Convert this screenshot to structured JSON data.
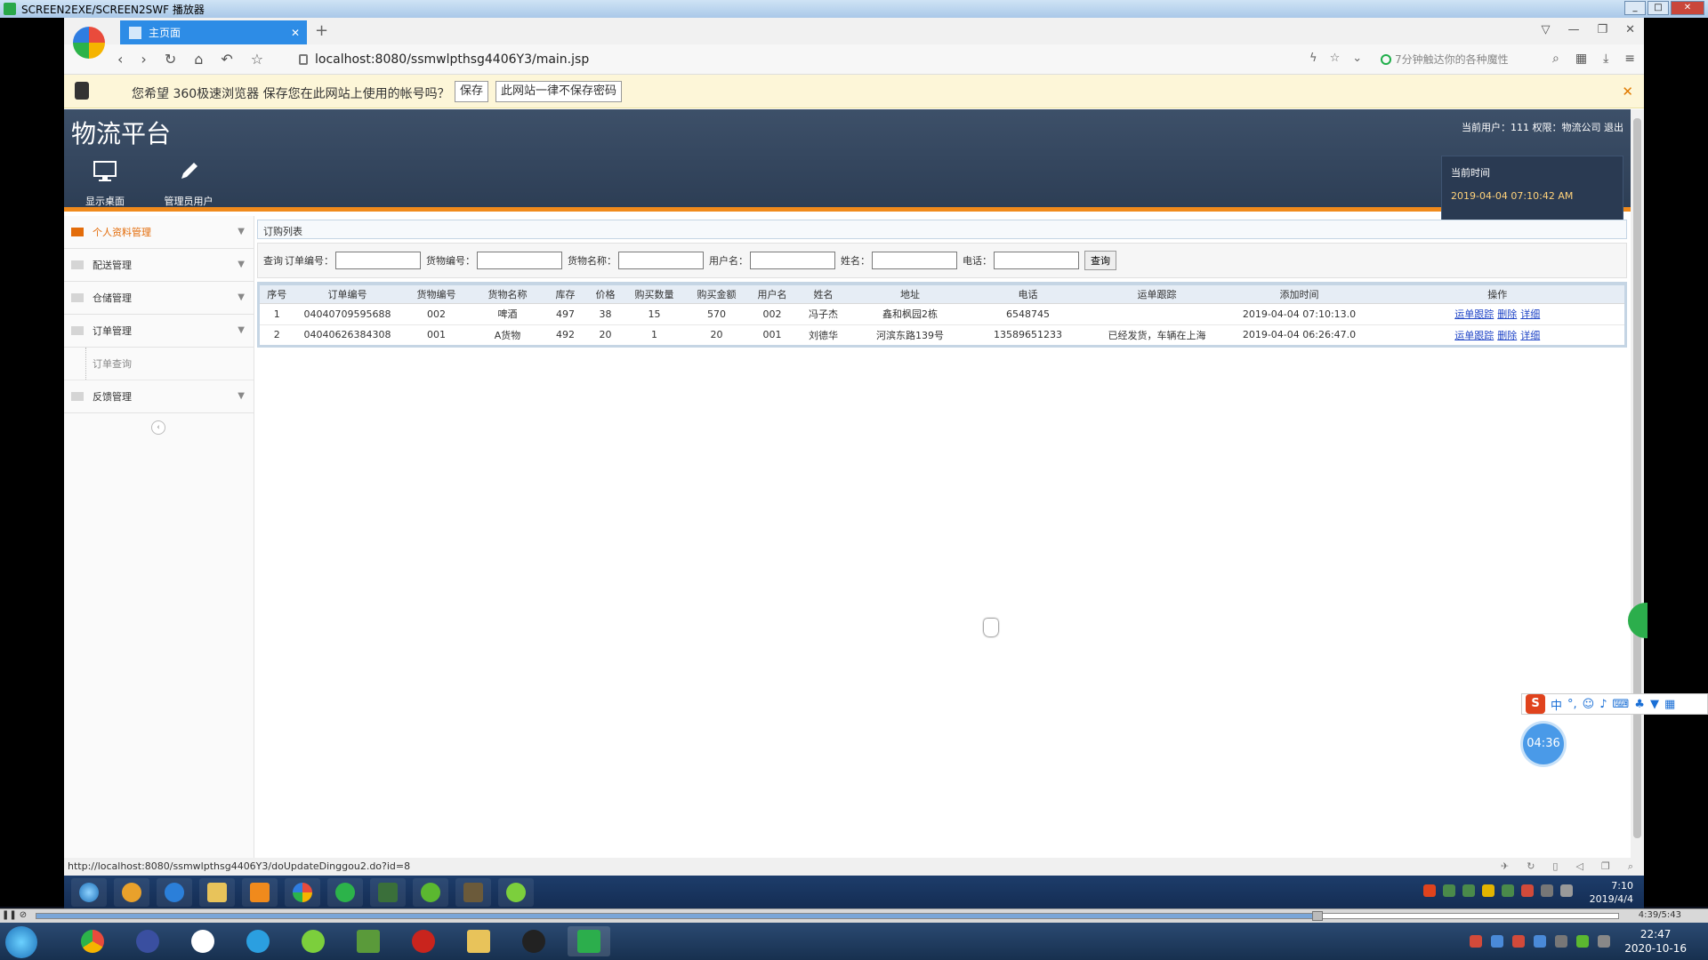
{
  "player": {
    "title": "SCREEN2EXE/SCREEN2SWF 播放器",
    "elapsed": "4:39/5:43",
    "progress": 0.81
  },
  "browser": {
    "tab_title": "主页面",
    "url": "localhost:8080/ssmwlpthsg4406Y3/main.jsp",
    "search_hint": "7分钟触达你的各种魔性",
    "status_url": "http://localhost:8080/ssmwlpthsg4406Y3/doUpdateDinggou2.do?id=8"
  },
  "password_bar": {
    "message": "您希望 360极速浏览器 保存您在此网站上使用的帐号吗？",
    "save_label": "保存",
    "never_label": "此网站一律不保存密码"
  },
  "site": {
    "title": "物流平台",
    "user_info": "当前用户：111  权限：物流公司  退出",
    "header_buttons": [
      "显示桌面",
      "管理员用户"
    ],
    "time_label": "当前时间",
    "time_value": "2019-04-04 07:10:42 AM"
  },
  "sidebar": {
    "items": [
      {
        "label": "个人资料管理",
        "active": true
      },
      {
        "label": "配送管理"
      },
      {
        "label": "仓储管理"
      },
      {
        "label": "订单管理"
      },
      {
        "label": "订单查询",
        "sub": true
      },
      {
        "label": "反馈管理"
      }
    ]
  },
  "content": {
    "list_title": "订购列表",
    "query_label": "查询",
    "fields": [
      "订单编号：",
      "货物编号：",
      "货物名称：",
      "用户名：",
      "姓名：",
      "电话："
    ],
    "query_button": "查询",
    "columns": [
      "序号",
      "订单编号",
      "货物编号",
      "货物名称",
      "库存",
      "价格",
      "购买数量",
      "购买金额",
      "用户名",
      "姓名",
      "地址",
      "电话",
      "运单跟踪",
      "添加时间",
      "操作"
    ],
    "rows": [
      [
        "1",
        "04040709595688",
        "002",
        "啤酒",
        "497",
        "38",
        "15",
        "570",
        "002",
        "冯子杰",
        "鑫和枫园2栋",
        "6548745",
        "",
        "2019-04-04 07:10:13.0"
      ],
      [
        "2",
        "04040626384308",
        "001",
        "A货物",
        "492",
        "20",
        "1",
        "20",
        "001",
        "刘德华",
        "河滨东路139号",
        "13589651233",
        "已经发货，车辆在上海",
        "2019-04-04 06:26:47.0"
      ]
    ],
    "actions": [
      "运单跟踪",
      "删除",
      "详细"
    ]
  },
  "inner_taskbar": {
    "time": "7:10",
    "date": "2019/4/4"
  },
  "outer_taskbar": {
    "time": "22:47",
    "date": "2020-10-16"
  },
  "ime": {
    "lang": "中"
  },
  "recorder": {
    "timer": "04:36"
  }
}
